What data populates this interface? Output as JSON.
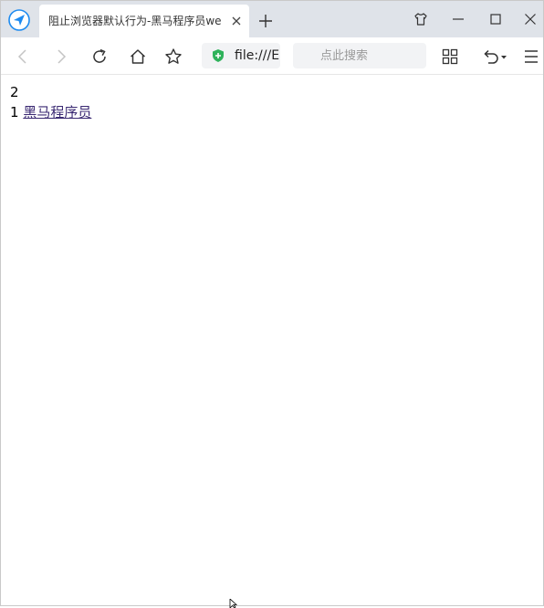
{
  "tab": {
    "title": "阻止浏览器默认行为-黑马程序员web"
  },
  "toolbar": {
    "url": "file:///E",
    "search_placeholder": "点此搜索"
  },
  "page": {
    "counter": "2",
    "link_prefix": "1 ",
    "link_text": "黑马程序员"
  },
  "colors": {
    "tabstrip": "#dfe3e9",
    "shield": "#2fb25b",
    "logo": "#1e8bf0",
    "link": "#3b2a73"
  },
  "icons": [
    "browser-logo-icon",
    "close-icon",
    "plus-icon",
    "tshirt-icon",
    "minimize-icon",
    "maximize-icon",
    "back-icon",
    "forward-icon",
    "reload-icon",
    "home-icon",
    "star-icon",
    "shield-icon",
    "search-icon",
    "grid-icon",
    "undo-icon",
    "menu-icon"
  ]
}
